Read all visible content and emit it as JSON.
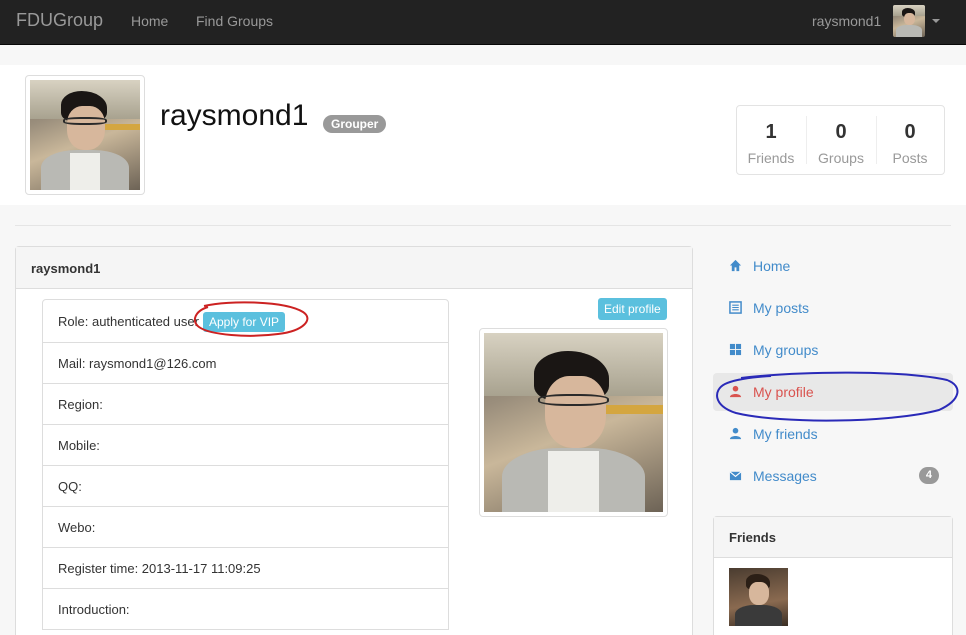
{
  "navbar": {
    "brand": "FDUGroup",
    "links": [
      "Home",
      "Find Groups"
    ],
    "user": "raysmond1"
  },
  "profile": {
    "username": "raysmond1",
    "role_badge": "Grouper",
    "stats": [
      {
        "value": "1",
        "label": "Friends"
      },
      {
        "value": "0",
        "label": "Groups"
      },
      {
        "value": "0",
        "label": "Posts"
      }
    ]
  },
  "panel": {
    "title": "raysmond1",
    "edit_button": "Edit profile",
    "vip_button": "Apply for VIP",
    "rows": [
      "Role: authenticated user",
      "Mail: raysmond1@126.com",
      "Region:",
      "Mobile:",
      "QQ:",
      "Webo:",
      "Register time: 2013-11-17 11:09:25",
      "Introduction:"
    ]
  },
  "sidebar": {
    "items": [
      {
        "label": "Home",
        "icon": "home-icon"
      },
      {
        "label": "My posts",
        "icon": "list-icon"
      },
      {
        "label": "My groups",
        "icon": "grid-icon"
      },
      {
        "label": "My profile",
        "icon": "user-icon"
      },
      {
        "label": "My friends",
        "icon": "user-icon"
      },
      {
        "label": "Messages",
        "icon": "envelope-icon",
        "badge": "4"
      }
    ],
    "active_index": 3
  },
  "friends": {
    "title": "Friends"
  },
  "colors": {
    "navbar": "#222222",
    "link": "#428bca",
    "active": "#d9534f",
    "info_button": "#5bc0de",
    "annotation_red": "#cc2222",
    "annotation_blue": "#2a2ab8"
  }
}
